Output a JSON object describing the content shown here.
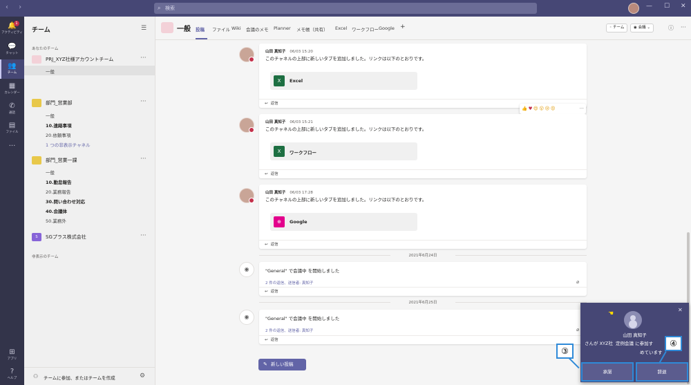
{
  "titlebar": {
    "search_placeholder": "検索",
    "nav": "‹ ›",
    "min": "—",
    "max": "☐",
    "close": "✕"
  },
  "rail": [
    {
      "label": "アクティビティ",
      "icon": "🔔",
      "badge": "1"
    },
    {
      "label": "チャット",
      "icon": "💬"
    },
    {
      "label": "チーム",
      "icon": "👥"
    },
    {
      "label": "カレンダー",
      "icon": "▦"
    },
    {
      "label": "通話",
      "icon": "✆"
    },
    {
      "label": "ファイル",
      "icon": "▤"
    },
    {
      "label": "",
      "icon": "···"
    },
    {
      "label": "アプリ",
      "icon": "⊞"
    },
    {
      "label": "ヘルプ",
      "icon": "?"
    }
  ],
  "panel": {
    "title": "チーム",
    "your_teams_label": "あなたのチーム",
    "hidden_teams_label": "非表示のチーム",
    "teams": [
      {
        "name": "PRJ_XYZ社様アカウントチーム",
        "color": "#f3d1d8",
        "channels": [
          {
            "name": "一般",
            "style": "selected"
          }
        ]
      },
      {
        "name": "部門_営業部",
        "color": "#e8c84a",
        "channels": [
          {
            "name": "一般",
            "style": ""
          },
          {
            "name": "10.連絡事項",
            "style": "bold"
          },
          {
            "name": "20.依頼事項",
            "style": ""
          },
          {
            "name": "1 つの非表示チャネル",
            "style": "link"
          }
        ]
      },
      {
        "name": "部門_営業一課",
        "color": "#e8c84a",
        "channels": [
          {
            "name": "一般",
            "style": ""
          },
          {
            "name": "10.勤怠報告",
            "style": "bold"
          },
          {
            "name": "20.業務報告",
            "style": ""
          },
          {
            "name": "30.問い合わせ対応",
            "style": "bold"
          },
          {
            "name": "40.会議体",
            "style": "bold"
          },
          {
            "name": "50.業務外",
            "style": ""
          }
        ]
      },
      {
        "name": "SGプラス株式会社",
        "color": "#8764d8",
        "logo_letter": "S",
        "channels": []
      }
    ],
    "footer_text": "チームに参加、またはチームを作成"
  },
  "header": {
    "channel_name": "一般",
    "tabs": [
      "投稿",
      "ファイル",
      "Wiki",
      "会議のメモ",
      "Planner",
      "メモ帳（共有）",
      "Excel",
      "ワークフロー",
      "Google",
      "+"
    ],
    "team_button": "チーム",
    "meet_button": "会議"
  },
  "messages": [
    {
      "author": "山田 真知子",
      "time": "06/03 15:20",
      "body": "このチャネルの上部に新しいタブを追加しました。リンクは以下のとおりです。",
      "card_label": "Excel",
      "card_icon": "X",
      "card_color": "#1d6f42",
      "reply": "返信"
    },
    {
      "author": "山田 真知子",
      "time": "06/03 15:21",
      "body": "このチャネルの上部に新しいタブを追加しました。リンクは以下のとおりです。",
      "card_label": "ワークフロー",
      "card_icon": "X",
      "card_color": "#1d6f42",
      "reply": "返信"
    },
    {
      "author": "山田 真知子",
      "time": "06/03 17:28",
      "body": "このチャネルの上部に新しいタブを追加しました。リンクは以下のとおりです。",
      "card_label": "Google",
      "card_icon": "⊕",
      "card_color": "#e3008c",
      "reply": "返信"
    }
  ],
  "dates": [
    "2021年6月24日",
    "2021年6月25日"
  ],
  "meetings": [
    {
      "title": "\"General\" で会議中 を開始しました",
      "replies": "2 件の返信、送信者: 真知子",
      "reply": "返信"
    },
    {
      "title": "\"General\" で会議中 を開始しました",
      "replies": "2 件の返信、送信者: 真知子",
      "reply": "返信"
    }
  ],
  "reactions": [
    "👍",
    "♥",
    "😄",
    "😲",
    "😢",
    "😡"
  ],
  "new_post_label": "新しい投稿",
  "toast": {
    "caller": "山田 真知子",
    "line1": "さんが XYZ社",
    "line2": "定例会議 に参加す",
    "line3": "めています",
    "accept_label": "承諾",
    "decline_label": "辞退",
    "accept_num": "③",
    "decline_num": "④"
  }
}
